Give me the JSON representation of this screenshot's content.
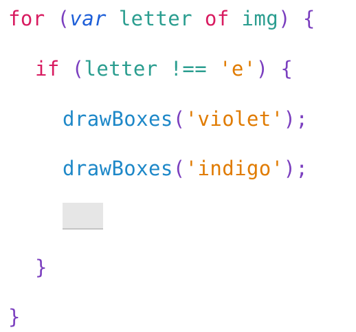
{
  "colors": {
    "keyword": "#d81b60",
    "var_keyword": "#1e5fd8",
    "identifier": "#2a9d8f",
    "function": "#1e88c8",
    "string": "#e07b00",
    "bracket": "#7b3fbf",
    "blank_slot": "#e6e6e6"
  },
  "lines": {
    "line1": {
      "kw_for": "for",
      "open_paren": "(",
      "kw_var": "var",
      "ident_letter": "letter",
      "kw_of": "of",
      "ident_img": "img",
      "close_paren": ")",
      "open_brace": "{"
    },
    "line2": {
      "kw_if": "if",
      "open_paren": "(",
      "ident_letter": "letter",
      "op": "!==",
      "str": "'e'",
      "close_paren": ")",
      "open_brace": "{"
    },
    "line3": {
      "fn": "drawBoxes",
      "open_paren": "(",
      "str": "'violet'",
      "close": ");"
    },
    "line4": {
      "fn": "drawBoxes",
      "open_paren": "(",
      "str": "'indigo'",
      "close": ");"
    },
    "line6": {
      "close_brace": "}"
    },
    "line7": {
      "close_brace": "}"
    }
  }
}
